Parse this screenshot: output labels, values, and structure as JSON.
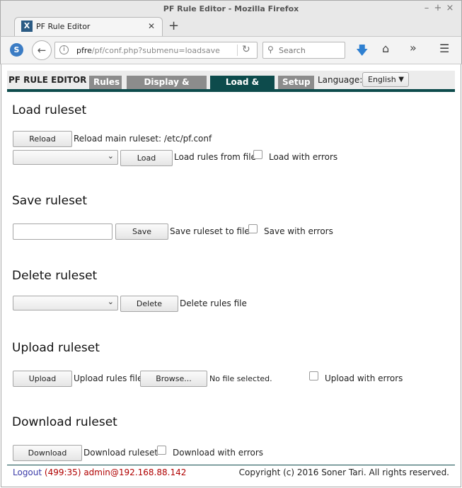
{
  "window": {
    "title": "PF Rule Editor - Mozilla Firefox",
    "controls": [
      "minimize",
      "maximize",
      "close"
    ]
  },
  "browser": {
    "tab_title": "PF Rule Editor",
    "url_host": "pfre",
    "url_path": "/pf/conf.php?submenu=loadsave",
    "search_placeholder": "Search",
    "icons": [
      "sync-icon",
      "back-icon",
      "info-icon",
      "reload-icon",
      "search-icon",
      "download-icon",
      "home-icon",
      "overflow-icon",
      "menu-icon"
    ]
  },
  "app": {
    "title": "PF RULE EDITOR",
    "tabs": [
      "Rules",
      "Display & Install",
      "Load & Save",
      "Setup"
    ],
    "active_tab": "Load & Save",
    "language_label": "Language:",
    "language_value": "English"
  },
  "load": {
    "heading": "Load ruleset",
    "reload_button": "Reload",
    "reload_text": "Reload main ruleset: /etc/pf.conf",
    "select_value": "",
    "load_button": "Load",
    "load_text": "Load rules from file",
    "errors_label": "Load with errors"
  },
  "save": {
    "heading": "Save ruleset",
    "input_value": "",
    "save_button": "Save",
    "save_text": "Save ruleset to file",
    "errors_label": "Save with errors"
  },
  "delete": {
    "heading": "Delete ruleset",
    "select_value": "",
    "delete_button": "Delete",
    "delete_text": "Delete rules file"
  },
  "upload": {
    "heading": "Upload ruleset",
    "upload_button": "Upload",
    "upload_text": "Upload rules file:",
    "browse_button": "Browse...",
    "file_status": "No file selected.",
    "errors_label": "Upload with errors"
  },
  "download": {
    "heading": "Download ruleset",
    "download_button": "Download",
    "download_text": "Download ruleset",
    "errors_label": "Download with errors"
  },
  "footer": {
    "logout": "Logout",
    "session": "(499:35) admin@192.168.88.142",
    "copyright": "Copyright (c) 2016 Soner Tari. All rights reserved."
  },
  "colors": {
    "accent": "#0d4b4c",
    "tab_inactive": "#8c8c8c",
    "session_text": "#b00000",
    "logout_link": "#3a3aa8"
  }
}
